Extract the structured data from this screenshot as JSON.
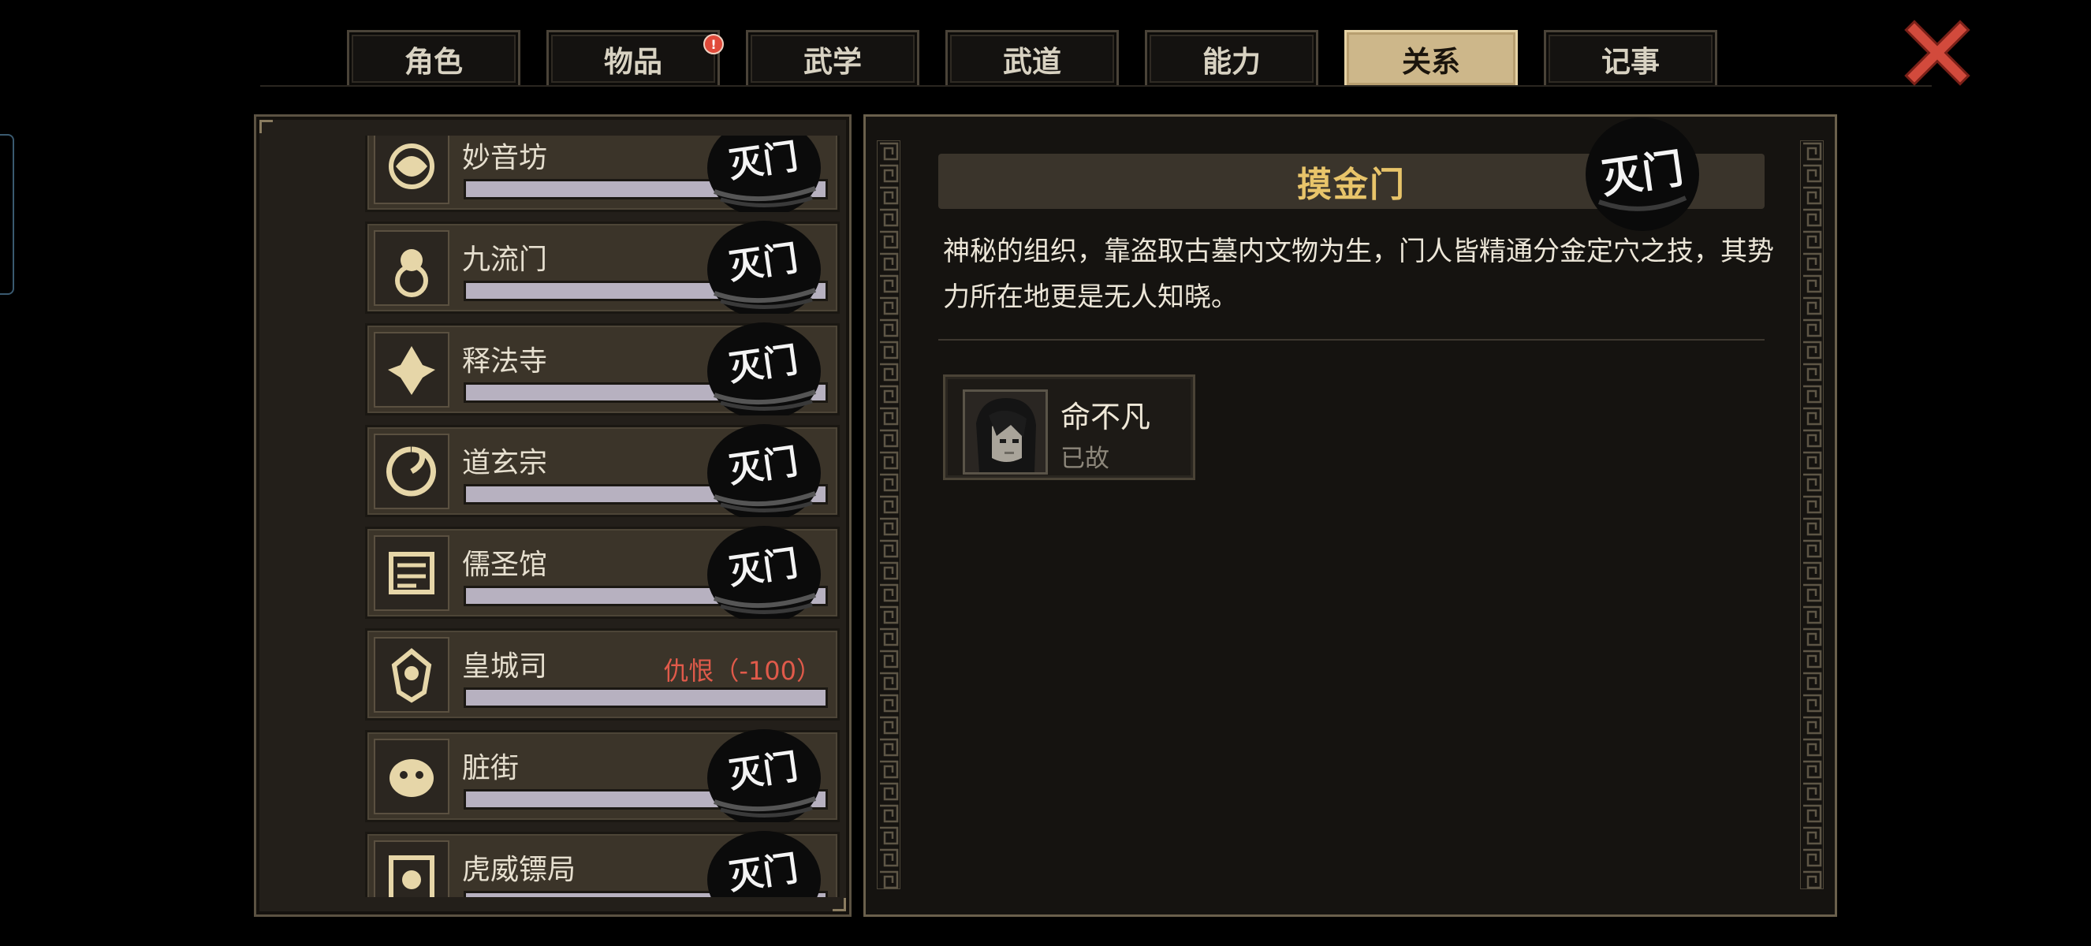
{
  "tabs": [
    {
      "label": "角色",
      "active": false,
      "badge": false
    },
    {
      "label": "物品",
      "active": false,
      "badge": true
    },
    {
      "label": "武学",
      "active": false,
      "badge": false
    },
    {
      "label": "武道",
      "active": false,
      "badge": false
    },
    {
      "label": "能力",
      "active": false,
      "badge": false
    },
    {
      "label": "关系",
      "active": true,
      "badge": false
    },
    {
      "label": "记事",
      "active": false,
      "badge": false
    }
  ],
  "badge_symbol": "!",
  "colors": {
    "background": "#000000",
    "tab_active": "#cdb78a",
    "panel": "#231f1a",
    "title_gold": "#e8c46a",
    "hostile_red": "#e05a4a",
    "bar_fill": "#b7b1c0",
    "close_red": "#d24a3c"
  },
  "factions": [
    {
      "name": "妙音坊",
      "icon": "fan-dancer-emblem-icon",
      "status": "",
      "seal": true
    },
    {
      "name": "九流门",
      "icon": "gourd-knot-emblem-icon",
      "status": "",
      "seal": true
    },
    {
      "name": "释法寺",
      "icon": "lotus-buddha-emblem-icon",
      "status": "",
      "seal": true
    },
    {
      "name": "道玄宗",
      "icon": "crane-swirl-emblem-icon",
      "status": "",
      "seal": true
    },
    {
      "name": "儒圣馆",
      "icon": "scroll-book-emblem-icon",
      "status": "",
      "seal": true
    },
    {
      "name": "皇城司",
      "icon": "imperial-guard-emblem-icon",
      "status": "仇恨（-100）",
      "seal": false
    },
    {
      "name": "脏街",
      "icon": "beast-face-emblem-icon",
      "status": "",
      "seal": true
    },
    {
      "name": "虎威镖局",
      "icon": "tiger-banner-emblem-icon",
      "status": "",
      "seal": true
    }
  ],
  "seal_text": "灭门",
  "detail": {
    "title": "摸金门",
    "description": "神秘的组织，靠盗取古墓内文物为生，门人皆精通分金定穴之技，其势力所在地更是无人知晓。",
    "members": [
      {
        "name": "命不凡",
        "status": "已故",
        "portrait": "long-haired-swordsman-portrait-icon"
      }
    ]
  }
}
